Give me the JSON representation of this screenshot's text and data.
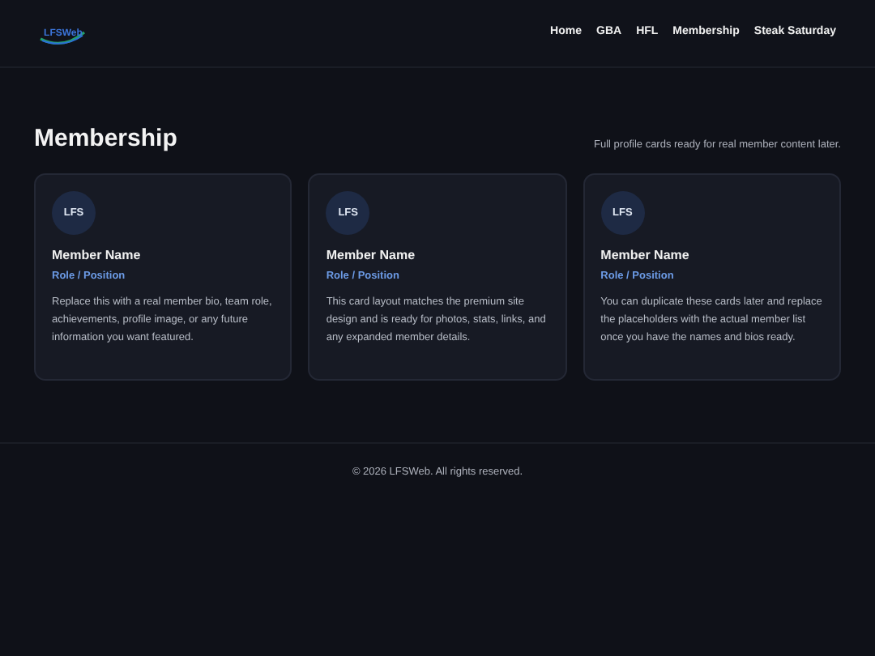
{
  "header": {
    "logo": "LFSWeb",
    "nav": [
      {
        "label": "Home"
      },
      {
        "label": "GBA"
      },
      {
        "label": "HFL"
      },
      {
        "label": "Membership"
      },
      {
        "label": "Steak Saturday"
      }
    ]
  },
  "section": {
    "title": "Membership",
    "subtitle": "Full profile cards ready for real member content later."
  },
  "cards": [
    {
      "avatar": "LFS",
      "name": "Member Name",
      "role": "Role / Position",
      "bio": "Replace this with a real member bio, team role, achievements, profile image, or any future information you want featured."
    },
    {
      "avatar": "LFS",
      "name": "Member Name",
      "role": "Role / Position",
      "bio": "This card layout matches the premium site design and is ready for photos, stats, links, and any expanded member details."
    },
    {
      "avatar": "LFS",
      "name": "Member Name",
      "role": "Role / Position",
      "bio": "You can duplicate these cards later and replace the placeholders with the actual member list once you have the names and bios ready."
    }
  ],
  "footer": "© 2026 LFSWeb. All rights reserved."
}
